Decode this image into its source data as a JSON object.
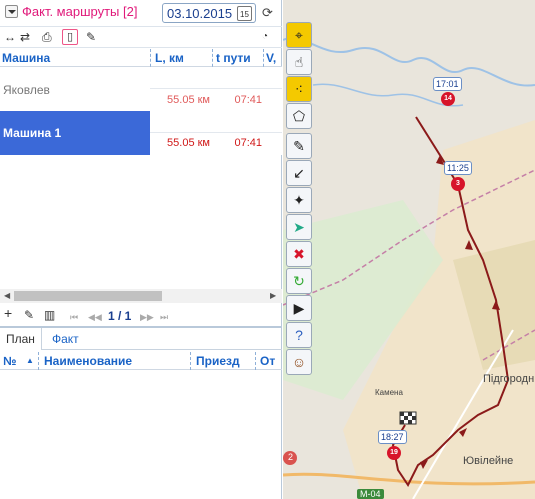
{
  "header": {
    "title": "Факт. маршруты [2]",
    "date": "03.10.2015",
    "calendar_day": "15"
  },
  "grid": {
    "columns": [
      "Машина",
      "L, км",
      "t пути",
      "V,"
    ],
    "rows": [
      {
        "name": "Яковлев",
        "distance": "55.05 км",
        "time": "07:41",
        "selected": false
      },
      {
        "name": "Машина 1",
        "distance": "55.05 км",
        "time": "07:41",
        "selected": true
      }
    ],
    "pager": "1 / 1"
  },
  "lower": {
    "tabs": [
      "План",
      "Факт"
    ],
    "active_tab": "План",
    "columns": [
      "№",
      "Наименование",
      "Приезд",
      "От"
    ]
  },
  "map": {
    "markers": [
      {
        "time": "17:01",
        "num": "14"
      },
      {
        "time": "11:25",
        "num": "3"
      },
      {
        "time": "18:27",
        "num": "19"
      }
    ],
    "places": [
      "Камена",
      "Підгородн",
      "Ювілейне"
    ],
    "road_badges": [
      "M-04",
      "2"
    ]
  },
  "colors": {
    "accent": "#e0197a",
    "header_text": "#1a63c6",
    "selection": "#3b69d8",
    "value_red": "#e05a5a",
    "route": "#8b1a1a",
    "marker": "#d7142a"
  },
  "icons": [
    "caret-down-icon",
    "calendar-icon",
    "refresh-icon",
    "expand-icon",
    "swap-icon",
    "print-icon",
    "document-icon",
    "wrench-icon",
    "rss-icon",
    "add-icon",
    "edit-icon",
    "delete-icon",
    "first-page-icon",
    "prev-page-icon",
    "next-page-icon",
    "last-page-icon",
    "crosshair-icon",
    "hand-icon",
    "dots-icon",
    "polygon-icon",
    "pen-icon",
    "collapse-icon",
    "magic-icon",
    "route-icon",
    "cancel-icon",
    "redo-icon",
    "video-icon",
    "help-icon",
    "owl-icon"
  ]
}
